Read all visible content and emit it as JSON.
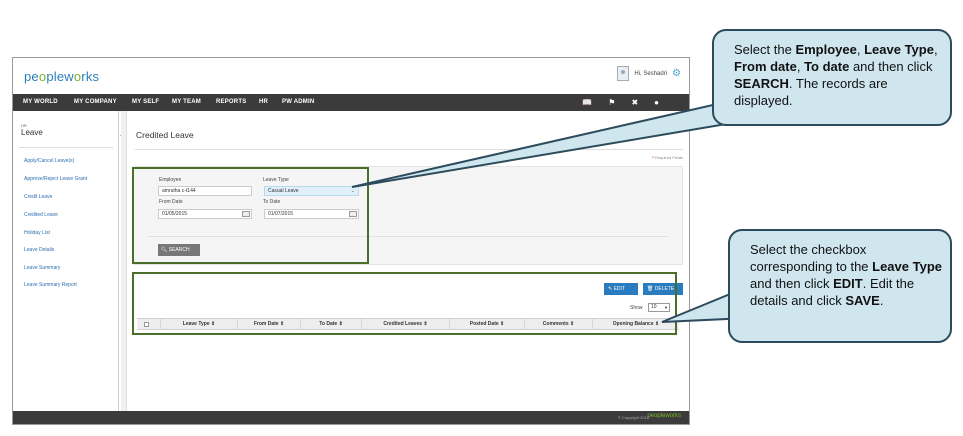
{
  "app": {
    "logo_part1": "pe",
    "logo_o": "o",
    "logo_part2": "ple",
    "logo_part3": "w",
    "logo_o2": "o",
    "logo_part4": "rks",
    "greeting": "Hi, Seshadri"
  },
  "nav": {
    "items": [
      "MY WORLD",
      "MY COMPANY",
      "MY SELF",
      "MY TEAM",
      "REPORTS",
      "HR",
      "PW ADMIN"
    ]
  },
  "sidebar": {
    "small_label": "HR",
    "title": "Leave",
    "items": [
      "Apply/Cancel Leave(s)",
      "Approve/Reject Leave Grant",
      "Credit Leave",
      "Credited Leave",
      "Holiday List",
      "Leave Details",
      "Leave Summary",
      "Leave Summary Report"
    ]
  },
  "main": {
    "title": "Credited Leave",
    "required_note": "Required Fields",
    "form": {
      "employee_label": "Employee",
      "employee_value": "amrutha c-t144",
      "leave_type_label": "Leave Type",
      "leave_type_value": "Casual Leave",
      "from_date_label": "From Date",
      "from_date_value": "01/05/2015",
      "to_date_label": "To Date",
      "to_date_value": "01/07/2015",
      "search_label": "SEARCH"
    },
    "list": {
      "edit_label": "EDIT",
      "delete_label": "DELETE",
      "show_label": "Show",
      "show_value": "10",
      "columns": [
        "Leave Type",
        "From Date",
        "To Date",
        "Credited Leaves",
        "Posted Date",
        "Comments",
        "Opening Balance"
      ]
    }
  },
  "footer": {
    "copyright": "© Copyright 2015",
    "logo": "peopleworks"
  },
  "callouts": {
    "top": {
      "t1": "Select the ",
      "b1": "Employee",
      "t2": ", ",
      "b2": "Leave Type",
      "t3": ", ",
      "b3": "From date",
      "t4": ", ",
      "b4": "To date",
      "t5": " and then click ",
      "b5": "SEARCH",
      "t6": ". The records are displayed."
    },
    "bottom": {
      "t1": "Select the checkbox corresponding to the ",
      "b1": "Leave Type",
      "t2": " and then click ",
      "b2": "EDIT",
      "t3": ". Edit the details and click ",
      "b3": "SAVE",
      "t4": "."
    }
  },
  "colors": {
    "accent": "#2a7bbf",
    "navbar": "#3b3b3b",
    "highlight": "#4a6f2a",
    "callout_bg": "#cfe6ef",
    "logo_green": "#7bb32e"
  }
}
